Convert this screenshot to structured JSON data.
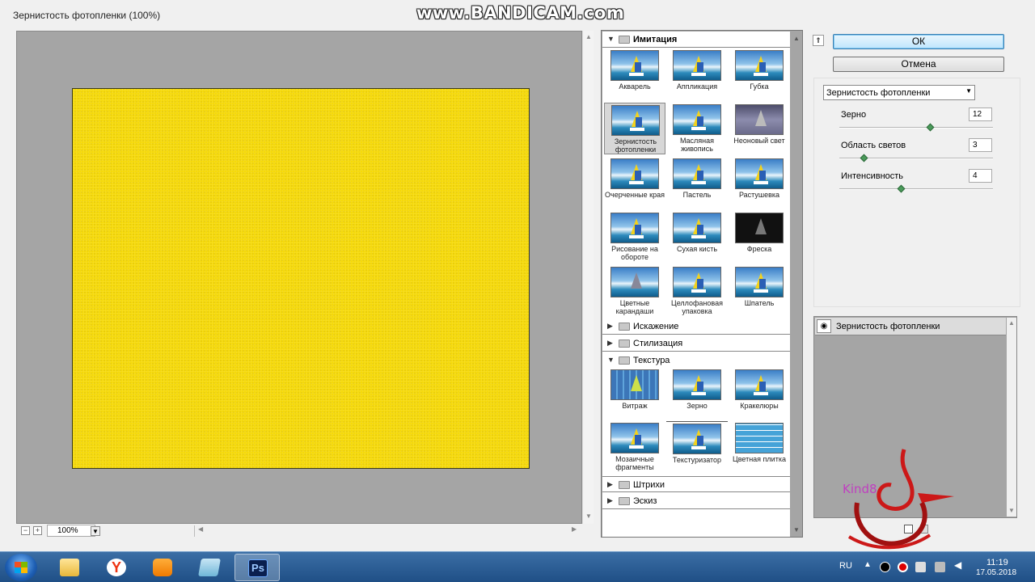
{
  "window": {
    "title": "Зернистость фотопленки (100%)"
  },
  "watermark": "www.BANDICAM.com",
  "preview": {
    "zoom": "100%"
  },
  "gallery": {
    "imitation": {
      "label": "Имитация",
      "items": [
        "Акварель",
        "Аппликация",
        "Губка",
        "Зернистость фотопленки",
        "Масляная живопись",
        "Неоновый свет",
        "Очерченные края",
        "Пастель",
        "Растушевка",
        "Рисование на обороте",
        "Сухая кисть",
        "Фреска",
        "Цветные карандаши",
        "Целлофановая упаковка",
        "Шпатель"
      ]
    },
    "distortion": {
      "label": "Искажение"
    },
    "stylize": {
      "label": "Стилизация"
    },
    "texture": {
      "label": "Текстура",
      "items": [
        "Витраж",
        "Зерно",
        "Кракелюры",
        "Мозаичные фрагменты",
        "Текстуризатор",
        "Цветная плитка"
      ]
    },
    "strokes": {
      "label": "Штрихи"
    },
    "sketch": {
      "label": "Эскиз"
    }
  },
  "buttons": {
    "ok": "ОК",
    "cancel": "Отмена"
  },
  "settings": {
    "filter_select": "Зернистость фотопленки",
    "grain": {
      "label": "Зерно",
      "value": "12"
    },
    "highlight_area": {
      "label": "Область светов",
      "value": "3"
    },
    "intensity": {
      "label": "Интенсивность",
      "value": "4"
    }
  },
  "layers": {
    "row_label": "Зернистость фотопленки"
  },
  "logo_text": "Kind8",
  "taskbar": {
    "lang": "RU",
    "time": "11:19",
    "date": "17.05.2018"
  },
  "colors": {
    "canvas_fill": "#f5d90a",
    "preview_bg": "#a5a5a5",
    "taskbar": "#2a5b94"
  },
  "icons": [
    "start-orb",
    "folder",
    "yandex-browser",
    "media-player",
    "app",
    "photoshop"
  ]
}
